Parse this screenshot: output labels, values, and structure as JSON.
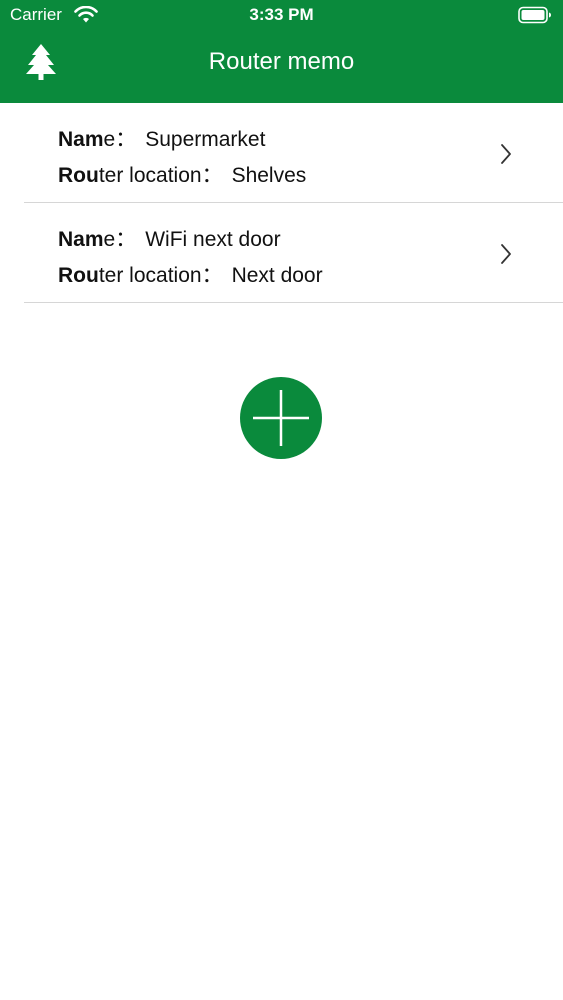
{
  "status_bar": {
    "carrier": "Carrier",
    "time": "3:33 PM"
  },
  "nav": {
    "title": "Router memo",
    "left_icon": "tree-icon"
  },
  "routers": [
    {
      "name_label_bold": "Nam",
      "name_label_rest": "e",
      "name_sep": "：",
      "name_value": "Supermarket",
      "location_label_bold": "Rou",
      "location_label_rest": "ter location",
      "location_sep": "：",
      "location_value": "Shelves"
    },
    {
      "name_label_bold": "Nam",
      "name_label_rest": "e",
      "name_sep": "：",
      "name_value": "WiFi next door",
      "location_label_bold": "Rou",
      "location_label_rest": "ter location",
      "location_sep": "：",
      "location_value": "Next door"
    }
  ],
  "add_button": {
    "icon": "plus-icon"
  },
  "colors": {
    "accent": "#0a8a3c",
    "divider": "#d6d6d6",
    "text": "#111111"
  }
}
